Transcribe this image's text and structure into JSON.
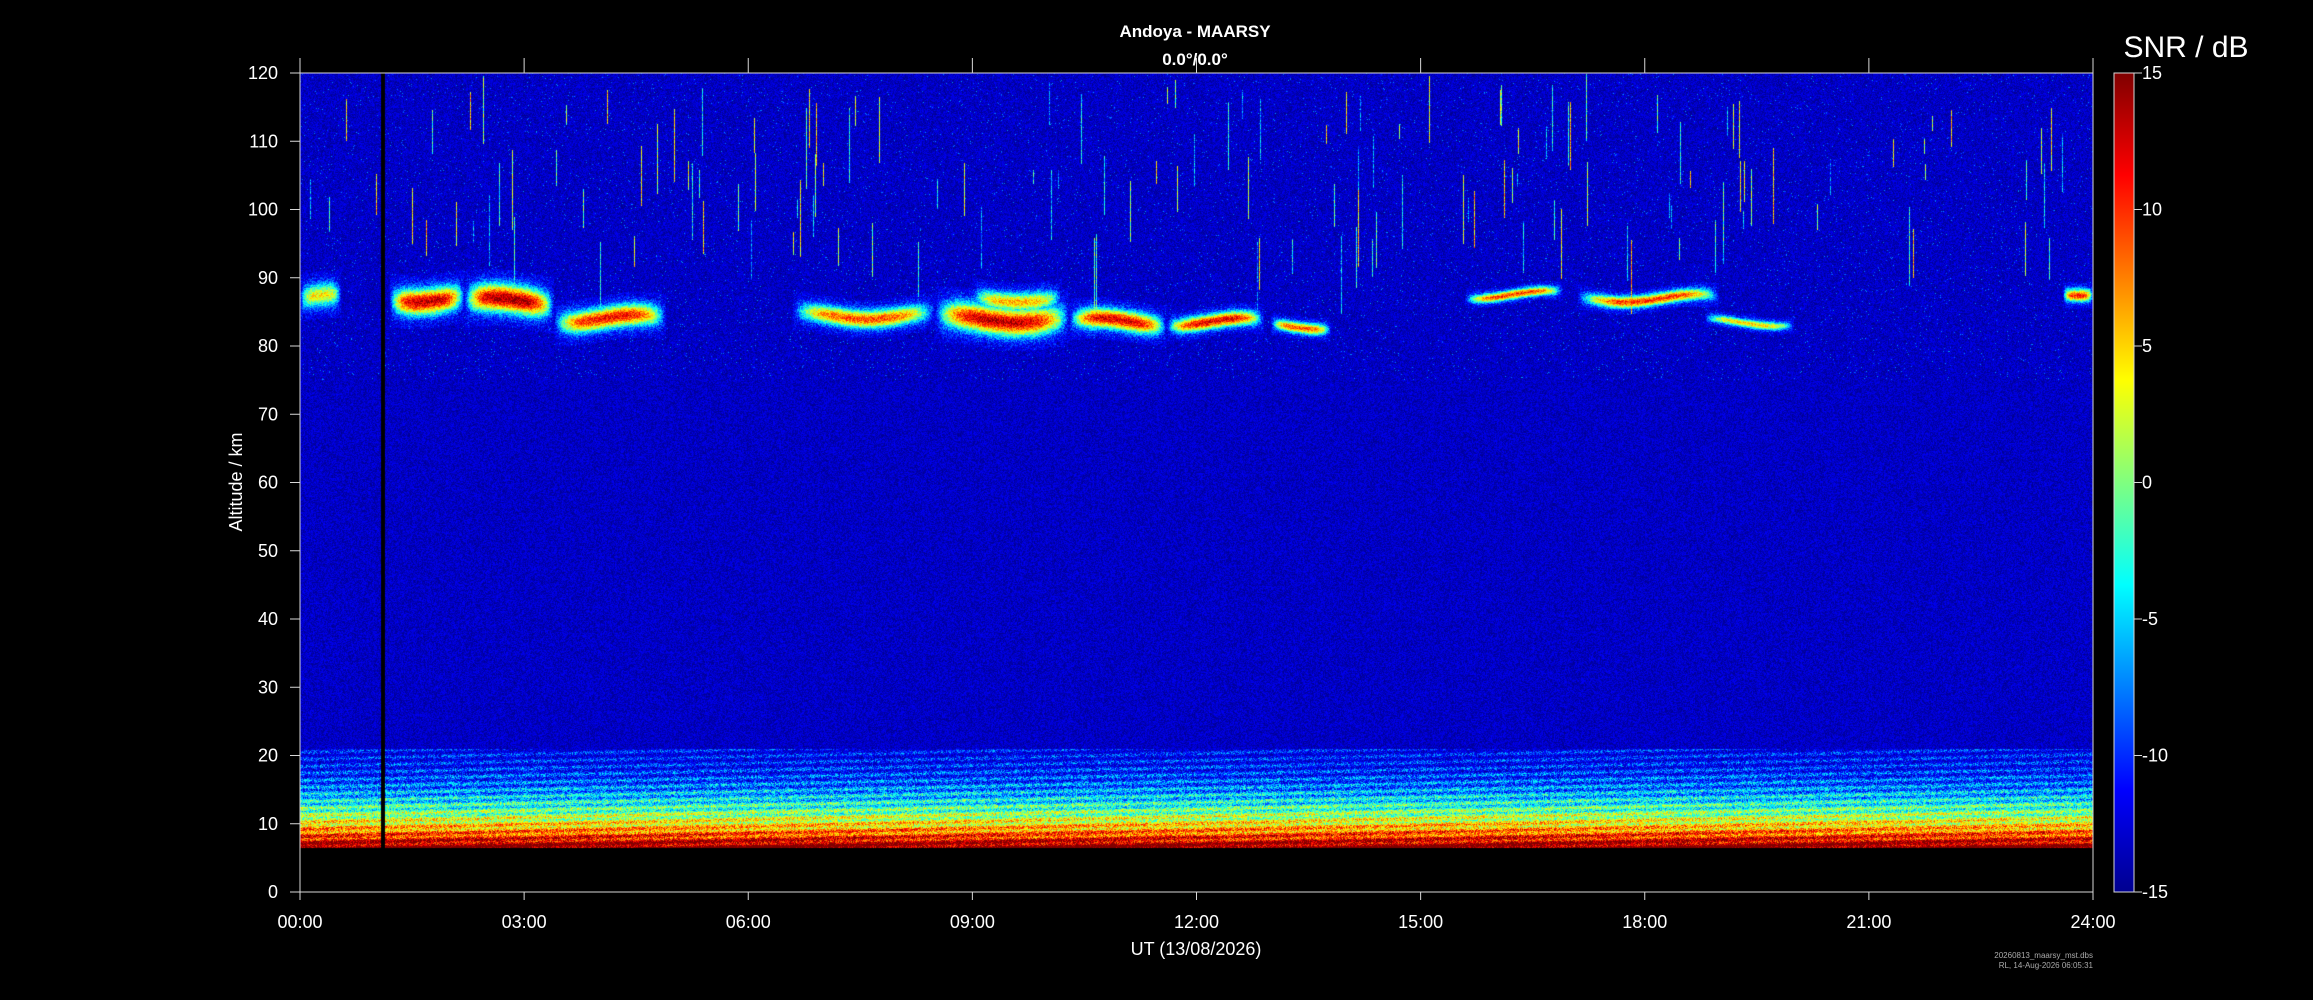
{
  "chart_data": {
    "type": "heatmap",
    "title": "Andoya - MAARSY",
    "subtitle": "0.0°/0.0°",
    "xlabel": "UT (13/08/2026)",
    "ylabel": "Altitude / km",
    "x_ticks": [
      "00:00",
      "03:00",
      "06:00",
      "09:00",
      "12:00",
      "15:00",
      "18:00",
      "21:00",
      "24:00"
    ],
    "xlim_hours": [
      0,
      24
    ],
    "y_ticks": [
      0,
      10,
      20,
      30,
      40,
      50,
      60,
      70,
      80,
      90,
      100,
      110,
      120
    ],
    "ylim": [
      0,
      120
    ],
    "colorbar": {
      "label": "SNR / dB",
      "ticks": [
        15,
        10,
        5,
        0,
        -5,
        -10,
        -15
      ],
      "range": [
        -15,
        15
      ],
      "colormap": "jet"
    },
    "data_gap_hours": [
      1.08,
      1.14
    ],
    "data_bottom_km": 6.5,
    "background_snr": -13,
    "features": [
      {
        "name": "PMSE layer",
        "segments": [
          {
            "t0": 0.0,
            "t1": 0.55,
            "alt": 87.0,
            "thick": 2.5,
            "snr": 4
          },
          {
            "t0": 1.2,
            "t1": 2.2,
            "alt": 87.0,
            "thick": 2.8,
            "snr": 13
          },
          {
            "t0": 2.2,
            "t1": 3.4,
            "alt": 86.5,
            "thick": 3.0,
            "snr": 14
          },
          {
            "t0": 3.4,
            "t1": 4.9,
            "alt": 84.0,
            "thick": 2.4,
            "snr": 11
          },
          {
            "t0": 6.6,
            "t1": 8.5,
            "alt": 84.5,
            "thick": 2.0,
            "snr": 9
          },
          {
            "t0": 8.5,
            "t1": 10.3,
            "alt": 84.0,
            "thick": 3.0,
            "snr": 13
          },
          {
            "t0": 9.0,
            "t1": 10.2,
            "alt": 87.0,
            "thick": 2.0,
            "snr": 6
          },
          {
            "t0": 10.3,
            "t1": 11.6,
            "alt": 83.5,
            "thick": 2.2,
            "snr": 12
          },
          {
            "t0": 11.6,
            "t1": 12.9,
            "alt": 83.5,
            "thick": 1.6,
            "snr": 12
          },
          {
            "t0": 13.0,
            "t1": 13.8,
            "alt": 83.0,
            "thick": 1.2,
            "snr": 9
          },
          {
            "t0": 15.6,
            "t1": 16.9,
            "alt": 87.5,
            "thick": 1.0,
            "snr": 10
          },
          {
            "t0": 17.1,
            "t1": 19.0,
            "alt": 87.0,
            "thick": 1.3,
            "snr": 10
          },
          {
            "t0": 18.8,
            "t1": 20.0,
            "alt": 83.5,
            "thick": 0.9,
            "snr": 5
          },
          {
            "t0": 23.6,
            "t1": 24.0,
            "alt": 88.0,
            "thick": 1.4,
            "snr": 10
          }
        ]
      },
      {
        "name": "Tropospheric echoes",
        "alt_range": [
          6.5,
          21
        ],
        "peak_snr": 15
      }
    ]
  },
  "footer": {
    "file": "20260813_maarsy_mst.dbs",
    "stamp": "RL, 14-Aug-2026 06:05:31"
  }
}
